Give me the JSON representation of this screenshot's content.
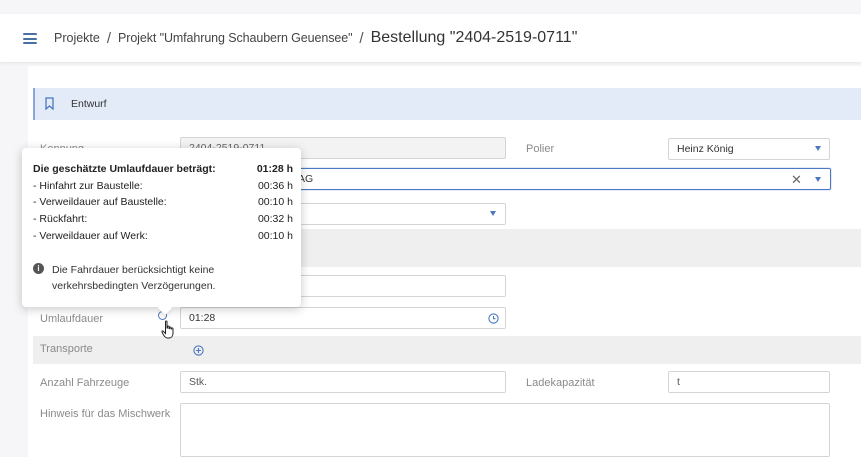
{
  "header": {
    "breadcrumb_1": "Projekte",
    "separator": "/",
    "breadcrumb_2": "Projekt \"Umfahrung Schaubern Geuensee\"",
    "breadcrumb_3": "Bestellung \"2404-2519-0711\""
  },
  "status": {
    "label": "Entwurf"
  },
  "form": {
    "kennung_label": "Kennung",
    "kennung_value": "2404-2519-0711",
    "polier_label": "Polier",
    "polier_value": "Heinz König",
    "partial_field_value": "AG",
    "umlaufdauer_label": "Umlaufdauer",
    "umlaufdauer_value": "01:28",
    "transporte_label": "Transporte",
    "anzahl_label": "Anzahl Fahrzeuge",
    "anzahl_placeholder": "Stk.",
    "ladekapazitaet_label": "Ladekapazität",
    "ladekapazitaet_placeholder": "t",
    "hinweis_label": "Hinweis für das Mischwerk"
  },
  "tooltip": {
    "title": "Die geschätzte Umlaufdauer beträgt:",
    "title_value": "01:28 h",
    "rows": [
      {
        "label": "- Hinfahrt zur Baustelle:",
        "value": "00:36 h"
      },
      {
        "label": "- Verweildauer auf Baustelle:",
        "value": "00:10 h"
      },
      {
        "label": "- Rückfahrt:",
        "value": "00:32 h"
      },
      {
        "label": "- Verweildauer auf Werk:",
        "value": "00:10 h"
      }
    ],
    "note_line_1": "Die Fahrdauer berücksichtigt keine",
    "note_line_2": "verkehrsbedingten Verzögerungen."
  },
  "colors": {
    "accent": "#4a78c2",
    "status_bg": "#e3ebf9",
    "band_bg": "#efefef"
  },
  "icons": [
    "hamburger-icon",
    "bookmark-icon",
    "chevron-down-icon",
    "close-icon",
    "info-icon",
    "clock-icon",
    "plus-circle-icon",
    "mouse-cursor-icon"
  ]
}
